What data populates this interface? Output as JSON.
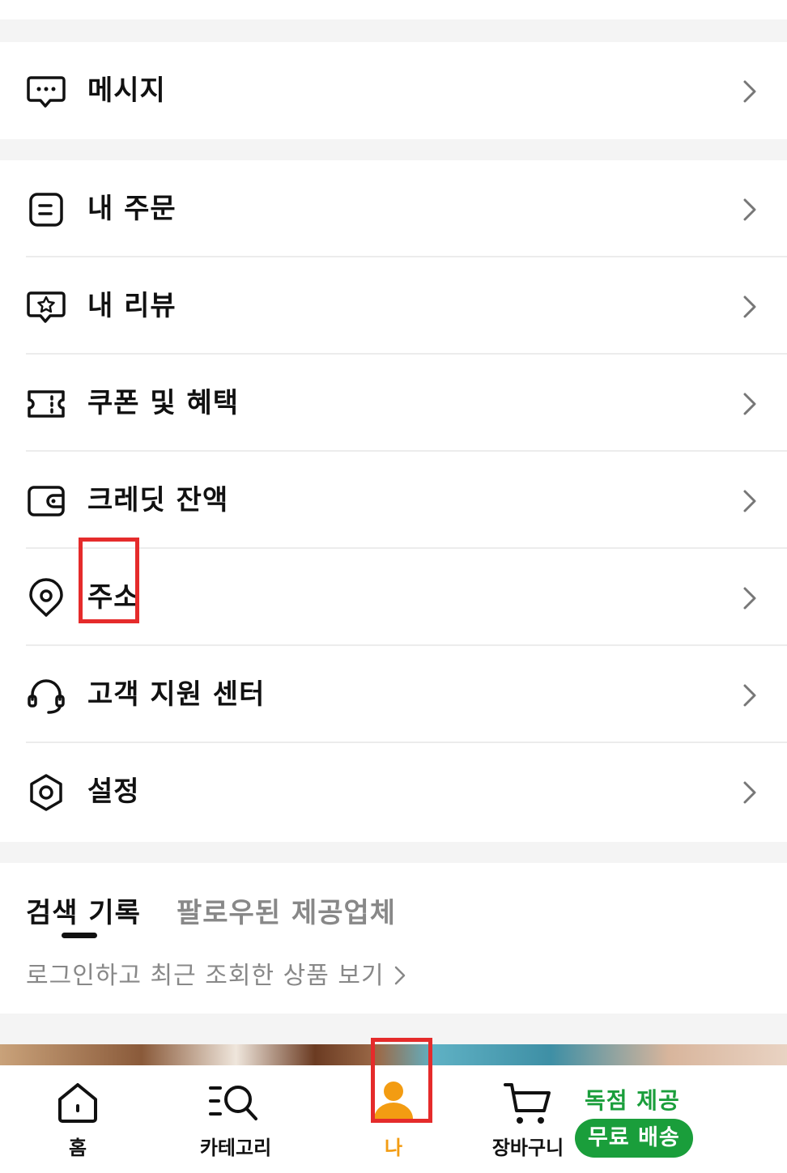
{
  "menu_top": {
    "message_label": "메시지"
  },
  "menu_main": {
    "orders_label": "내 주문",
    "reviews_label": "내 리뷰",
    "coupons_label": "쿠폰 및 혜택",
    "credit_label": "크레딧 잔액",
    "address_label": "주소",
    "support_label": "고객 지원 센터",
    "settings_label": "설정"
  },
  "history": {
    "tab_search": "검색 기록",
    "tab_followed": "팔로우된 제공업체",
    "login_prompt": "로그인하고 최근 조회한 상품 보기"
  },
  "bottom_nav": {
    "home": "홈",
    "category": "카테고리",
    "me": "나",
    "cart": "장바구니",
    "promo_top": "독점 제공",
    "promo_badge": "무료 배송"
  },
  "colors": {
    "accent": "#f39c12",
    "promo_green": "#1a9e3b",
    "highlight": "#e52b2b"
  }
}
